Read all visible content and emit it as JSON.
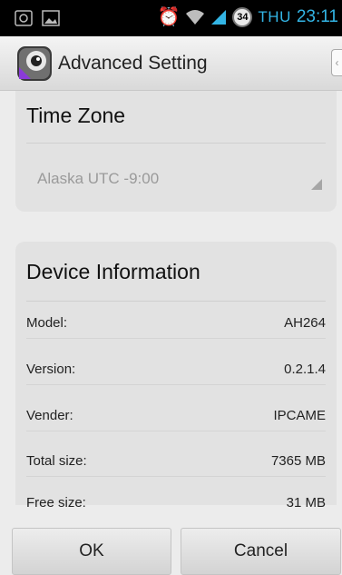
{
  "status_bar": {
    "day": "THU",
    "time": "23:11",
    "badge": "34"
  },
  "action_bar": {
    "title": "Advanced Setting"
  },
  "time_zone": {
    "title": "Time Zone",
    "selected": "Alaska UTC -9:00"
  },
  "device_info": {
    "title": "Device Information",
    "rows": [
      {
        "label": "Model:",
        "value": "AH264"
      },
      {
        "label": "Version:",
        "value": "0.2.1.4"
      },
      {
        "label": "Vender:",
        "value": "IPCAME"
      },
      {
        "label": "Total size:",
        "value": "7365 MB"
      },
      {
        "label": "Free size:",
        "value": "31 MB"
      }
    ]
  },
  "buttons": {
    "ok": "OK",
    "cancel": "Cancel"
  },
  "colors": {
    "status_accent": "#33b5e5",
    "card_bg": "#e2e2e2"
  }
}
